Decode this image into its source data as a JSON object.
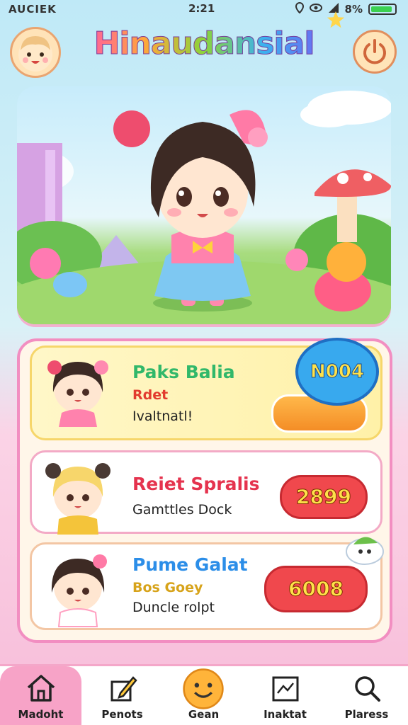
{
  "status_bar": {
    "carrier": "AUCIEK",
    "time": "2:21",
    "battery": "8%",
    "battery_level": 0.92
  },
  "header": {
    "title": "Hinaudansial"
  },
  "cards": [
    {
      "title": "Paks Balia",
      "subtitle": "Rdet",
      "detail": "Ivaltnatl!",
      "badge": "N004",
      "title_color": "#31b86a",
      "subtitle_color": "#e23b2e"
    },
    {
      "title": "Reiet Spralis",
      "detail": "Gamttles Dock",
      "badge": "2899",
      "title_color": "#e5334e"
    },
    {
      "title": "Pume Galat",
      "subtitle": "Bos Goey",
      "detail": "Duncle rolpt",
      "badge": "6008",
      "title_color": "#2c8ee8",
      "subtitle_color": "#d7a31a"
    }
  ],
  "tabs": [
    {
      "label": "Madoht",
      "icon": "home-icon",
      "active": true
    },
    {
      "label": "Penots",
      "icon": "pen-icon",
      "active": false
    },
    {
      "label": "Gean",
      "icon": "smiley-icon",
      "active": false
    },
    {
      "label": "Inaktat",
      "icon": "frame-icon",
      "active": false
    },
    {
      "label": "Plaress",
      "icon": "search-icon",
      "active": false
    }
  ],
  "colors": {
    "accent_pink": "#f28ec1",
    "tab_active": "#f7a3c7",
    "badge_red": "#f0484d"
  }
}
